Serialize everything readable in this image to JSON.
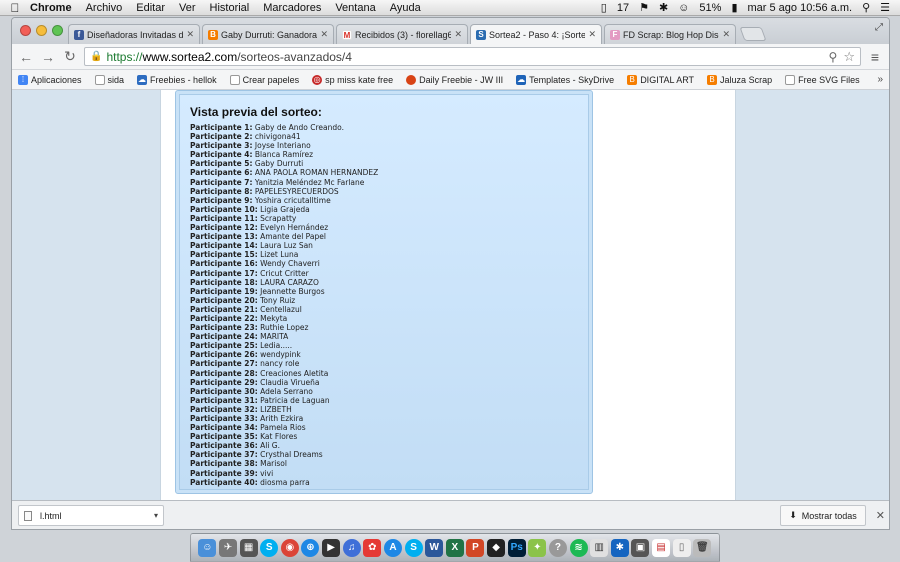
{
  "menubar": {
    "app": "Chrome",
    "items": [
      "Archivo",
      "Editar",
      "Ver",
      "Historial",
      "Marcadores",
      "Ventana",
      "Ayuda"
    ],
    "status": {
      "num": "17",
      "battery": "51%",
      "datetime": "mar 5 ago  10:56 a.m."
    }
  },
  "tabs": [
    {
      "title": "Diseñadoras Invitadas de",
      "color": "#3b5998",
      "glyph": "f"
    },
    {
      "title": "Gaby Durruti: Ganadora de",
      "color": "#f57d00",
      "glyph": "B"
    },
    {
      "title": "Recibidos (3) - florellag69",
      "color": "#d93025",
      "glyph": "M"
    },
    {
      "title": "Sortea2 - Paso 4: ¡Sorteal",
      "color": "#2b6cb0",
      "glyph": "S"
    },
    {
      "title": "FD Scrap: Blog Hop Diseña",
      "color": "#e39bc3",
      "glyph": "F"
    }
  ],
  "toolbar": {
    "url_scheme": "https://",
    "url_host": "www.sortea2.com",
    "url_path": "/sorteos-avanzados/4"
  },
  "bookmarks": [
    {
      "label": "Aplicaciones",
      "color": "#4285f4"
    },
    {
      "label": "sida",
      "color": "#9e9e9e"
    },
    {
      "label": "Freebies - hellok",
      "color": "#2d6cc0"
    },
    {
      "label": "Crear papeles",
      "color": "#9e9e9e"
    },
    {
      "label": "sp miss kate free",
      "color": "#c62828"
    },
    {
      "label": "Daily Freebie - JW III",
      "color": "#d84315"
    },
    {
      "label": "Templates - SkyDrive",
      "color": "#1e63b8"
    },
    {
      "label": "DIGITAL ART",
      "color": "#f57d00"
    },
    {
      "label": "Jaluza Scrap",
      "color": "#f57d00"
    },
    {
      "label": "Free SVG Files",
      "color": "#9e9e9e"
    }
  ],
  "preview": {
    "title": "Vista previa del sorteo:",
    "label_prefix": "Participante",
    "participants": [
      "Gaby de Ando Creando.",
      "chivigona41",
      "Joyse Interiano",
      "Blanca Ramírez",
      "Gaby Durruti",
      "ANA PAOLA ROMAN HERNANDEZ",
      "Yanitzia Meléndez Mc Farlane",
      "PAPELESYRECUERDOS",
      "Yoshira cricutalltime",
      "Ligia Grajeda",
      "Scrapatty",
      "Evelyn Hernández",
      "Amante del Papel",
      "Laura Luz San",
      "Lizet Luna",
      "Wendy Chaverri",
      "Cricut Critter",
      "LAURA CARAZO",
      "Jeannette Burgos",
      "Tony Ruiz",
      "Centellazul",
      "Mekyta",
      "Ruthie Lopez",
      "MARITA",
      "Ledia.....",
      "wendypink",
      "nancy role",
      "Creaciones Aletita",
      "Claudia Virueña",
      "Adela Serrano",
      "Patricia de Laguan",
      "LIZBETH",
      "Arith Ezkira",
      "Pamela Rios",
      "Kat Flores",
      "Ali G.",
      "Crysthal Dreams",
      "Marisol",
      "vivi",
      "diosma parra"
    ]
  },
  "downloads": {
    "file": "l.html",
    "show_all": "Mostrar todas"
  }
}
